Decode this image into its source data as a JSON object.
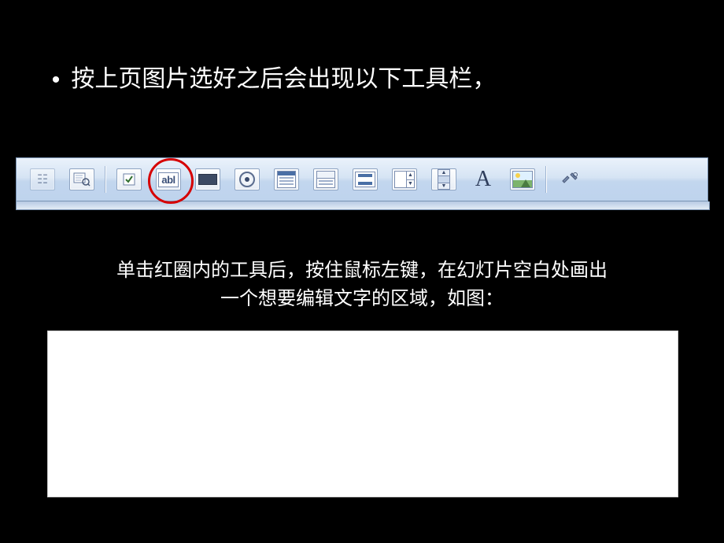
{
  "bullet": {
    "dot": "•",
    "text": "按上页图片选好之后会出现以下工具栏，"
  },
  "toolbar": {
    "items": [
      {
        "name": "properties-icon",
        "label": "属性窗口"
      },
      {
        "name": "view-code-icon",
        "label": "查看代码"
      },
      {
        "name": "checkbox-icon",
        "label": "复选框"
      },
      {
        "name": "textbox-icon",
        "label": "文本框",
        "highlighted": true,
        "glyph": "abl"
      },
      {
        "name": "commandbutton-icon",
        "label": "命令按钮"
      },
      {
        "name": "optionbutton-icon",
        "label": "选项按钮"
      },
      {
        "name": "listbox-icon",
        "label": "列表框"
      },
      {
        "name": "combobox-icon",
        "label": "组合框"
      },
      {
        "name": "togglebutton-icon",
        "label": "切换按钮"
      },
      {
        "name": "spinbutton-icon",
        "label": "数值调节"
      },
      {
        "name": "scrollbar-icon",
        "label": "滚动条"
      },
      {
        "name": "label-icon",
        "label": "标签",
        "glyph": "A"
      },
      {
        "name": "image-icon",
        "label": "图像"
      },
      {
        "name": "moretools-icon",
        "label": "其他控件"
      }
    ],
    "separators_after": [
      1,
      12
    ]
  },
  "caption": {
    "line1": "单击红圈内的工具后，按住鼠标左键，在幻灯片空白处画出",
    "line2": "一个想要编辑文字的区域，如图："
  }
}
